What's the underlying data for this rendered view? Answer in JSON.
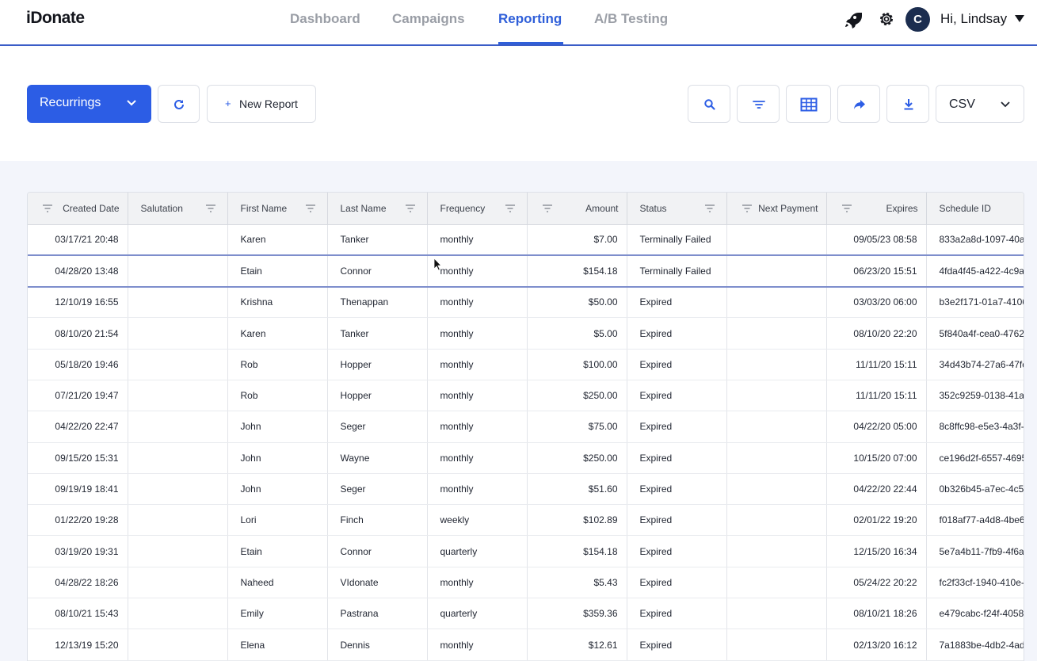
{
  "header": {
    "logo": "iDonate",
    "nav": [
      {
        "label": "Dashboard"
      },
      {
        "label": "Campaigns"
      },
      {
        "label": "Reporting"
      },
      {
        "label": "A/B Testing"
      }
    ],
    "active_nav": "Reporting",
    "avatar_initial": "C",
    "greeting": "Hi, Lindsay"
  },
  "toolbar": {
    "report_type": "Recurrings",
    "new_report_label": "New Report",
    "new_report_plus": "+",
    "export_format": "CSV",
    "icons": [
      "refresh-icon",
      "search-icon",
      "filter-icon",
      "table-icon",
      "share-icon",
      "download-icon"
    ]
  },
  "colors": {
    "primary": "#2c5de5",
    "nav_active": "#2f5fd9",
    "avatar_bg": "#1b2d4f",
    "content_bg": "#f3f5fb"
  },
  "table": {
    "columns": [
      {
        "label": "Created Date"
      },
      {
        "label": "Salutation"
      },
      {
        "label": "First Name"
      },
      {
        "label": "Last Name"
      },
      {
        "label": "Frequency"
      },
      {
        "label": "Amount"
      },
      {
        "label": "Status"
      },
      {
        "label": "Next Payment"
      },
      {
        "label": "Expires"
      },
      {
        "label": "Schedule ID"
      }
    ],
    "rows": [
      {
        "created": "03/17/21 20:48",
        "salutation": "",
        "first": "Karen",
        "last": "Tanker",
        "frequency": "monthly",
        "amount": "$7.00",
        "status": "Terminally Failed",
        "next": "",
        "expires": "09/05/23 08:58",
        "schedule": "833a2a8d-1097-40a"
      },
      {
        "created": "04/28/20 13:48",
        "salutation": "",
        "first": "Etain",
        "last": "Connor",
        "frequency": "monthly",
        "amount": "$154.18",
        "status": "Terminally Failed",
        "next": "",
        "expires": "06/23/20 15:51",
        "schedule": "4fda4f45-a422-4c9a"
      },
      {
        "created": "12/10/19 16:55",
        "salutation": "",
        "first": "Krishna",
        "last": "Thenappan",
        "frequency": "monthly",
        "amount": "$50.00",
        "status": "Expired",
        "next": "",
        "expires": "03/03/20 06:00",
        "schedule": "b3e2f171-01a7-4106"
      },
      {
        "created": "08/10/20 21:54",
        "salutation": "",
        "first": "Karen",
        "last": "Tanker",
        "frequency": "monthly",
        "amount": "$5.00",
        "status": "Expired",
        "next": "",
        "expires": "08/10/20 22:20",
        "schedule": "5f840a4f-cea0-4762"
      },
      {
        "created": "05/18/20 19:46",
        "salutation": "",
        "first": "Rob",
        "last": "Hopper",
        "frequency": "monthly",
        "amount": "$100.00",
        "status": "Expired",
        "next": "",
        "expires": "11/11/20 15:11",
        "schedule": "34d43b74-27a6-47fc"
      },
      {
        "created": "07/21/20 19:47",
        "salutation": "",
        "first": "Rob",
        "last": "Hopper",
        "frequency": "monthly",
        "amount": "$250.00",
        "status": "Expired",
        "next": "",
        "expires": "11/11/20 15:11",
        "schedule": "352c9259-0138-41a"
      },
      {
        "created": "04/22/20 22:47",
        "salutation": "",
        "first": "John",
        "last": "Seger",
        "frequency": "monthly",
        "amount": "$75.00",
        "status": "Expired",
        "next": "",
        "expires": "04/22/20 05:00",
        "schedule": "8c8ffc98-e5e3-4a3f-"
      },
      {
        "created": "09/15/20 15:31",
        "salutation": "",
        "first": "John",
        "last": "Wayne",
        "frequency": "monthly",
        "amount": "$250.00",
        "status": "Expired",
        "next": "",
        "expires": "10/15/20 07:00",
        "schedule": "ce196d2f-6557-4695"
      },
      {
        "created": "09/19/19 18:41",
        "salutation": "",
        "first": "John",
        "last": "Seger",
        "frequency": "monthly",
        "amount": "$51.60",
        "status": "Expired",
        "next": "",
        "expires": "04/22/20 22:44",
        "schedule": "0b326b45-a7ec-4c5c"
      },
      {
        "created": "01/22/20 19:28",
        "salutation": "",
        "first": "Lori",
        "last": "Finch",
        "frequency": "weekly",
        "amount": "$102.89",
        "status": "Expired",
        "next": "",
        "expires": "02/01/22 19:20",
        "schedule": "f018af77-a4d8-4be6"
      },
      {
        "created": "03/19/20 19:31",
        "salutation": "",
        "first": "Etain",
        "last": "Connor",
        "frequency": "quarterly",
        "amount": "$154.18",
        "status": "Expired",
        "next": "",
        "expires": "12/15/20 16:34",
        "schedule": "5e7a4b11-7fb9-4f6a"
      },
      {
        "created": "04/28/22 18:26",
        "salutation": "",
        "first": "Naheed",
        "last": "VIdonate",
        "frequency": "monthly",
        "amount": "$5.43",
        "status": "Expired",
        "next": "",
        "expires": "05/24/22 20:22",
        "schedule": "fc2f33cf-1940-410e-"
      },
      {
        "created": "08/10/21 15:43",
        "salutation": "",
        "first": "Emily",
        "last": "Pastrana",
        "frequency": "quarterly",
        "amount": "$359.36",
        "status": "Expired",
        "next": "",
        "expires": "08/10/21 18:26",
        "schedule": "e479cabc-f24f-4058"
      },
      {
        "created": "12/13/19 15:20",
        "salutation": "",
        "first": "Elena",
        "last": "Dennis",
        "frequency": "monthly",
        "amount": "$12.61",
        "status": "Expired",
        "next": "",
        "expires": "02/13/20 16:12",
        "schedule": "7a1883be-4db2-4ad"
      }
    ]
  }
}
